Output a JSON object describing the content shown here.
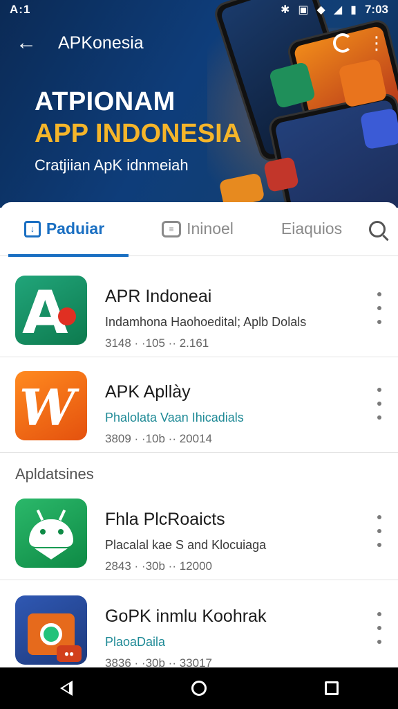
{
  "status_bar": {
    "left_text": "A:1",
    "time": "7:03",
    "icons": [
      "bluetooth-icon",
      "nfc-icon",
      "wifi-icon",
      "signal-icon",
      "battery-icon"
    ]
  },
  "header": {
    "title": "APKonesia",
    "headline": "ATPIONAM",
    "subheadline": "APP INDONESIA",
    "caption": "Cratjiian ApK idnmeiah"
  },
  "tabs": [
    {
      "label": "Paduiar",
      "icon": "shopping-bag-icon",
      "active": true
    },
    {
      "label": "Ininoel",
      "icon": "chat-icon",
      "active": false
    },
    {
      "label": "Eiaquios",
      "active": false
    }
  ],
  "section_title": "Apldatsines",
  "apps": [
    {
      "name": "APR Indoneai",
      "desc": "Indamhona Haohoedital; Aplb Dolals",
      "meta": "3148 · ·105 ·· 2.161",
      "icon": "a-letter-icon"
    },
    {
      "name": "APK Apllày",
      "desc": "Phalolata Vaan Ihicadials",
      "meta": "3809 · ·10b ·· 20014",
      "icon": "w-letter-icon"
    },
    {
      "name": "Fhla PlcRoaicts",
      "desc": "Placalal kae S and Klocuiaga",
      "meta": "2843 · ·30b ·· 12000",
      "icon": "android-robot-icon"
    },
    {
      "name": "GoPK inmlu Koohrak",
      "desc": "PlaoaDaila",
      "meta": "3836 · ·30b ·· 33017",
      "icon": "robot-game-icon"
    }
  ],
  "colors": {
    "accent": "#1a6fc2",
    "hero_bg": "#0e3d7a",
    "highlight": "#f5b52a",
    "teal_text": "#1f8a96"
  }
}
